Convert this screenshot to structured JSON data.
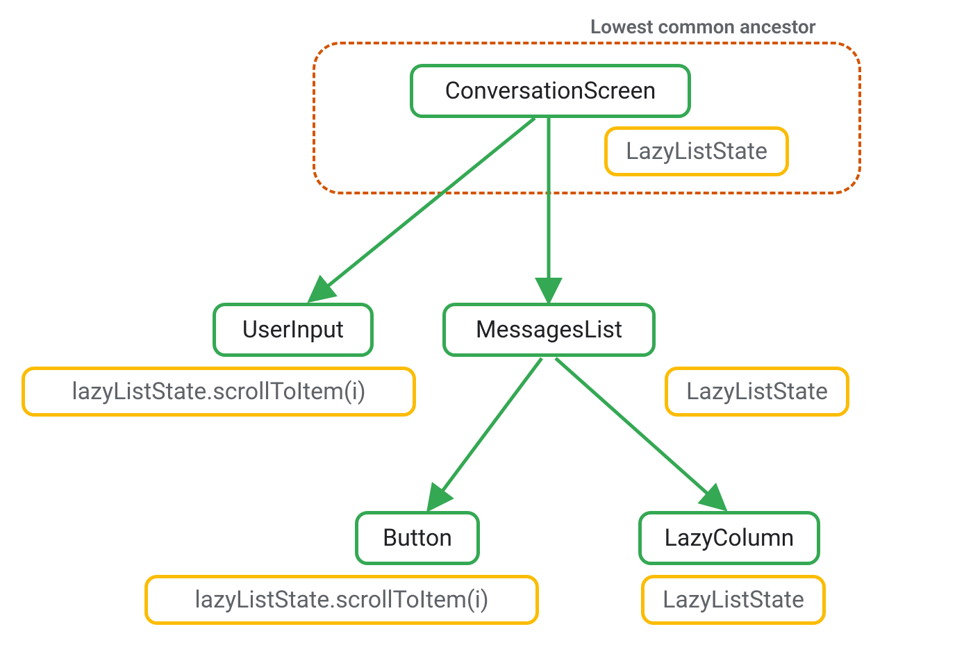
{
  "title_label": "Lowest common ancestor",
  "nodes": {
    "conversation_screen": "ConversationScreen",
    "conversation_screen_state": "LazyListState",
    "user_input": "UserInput",
    "user_input_state": "lazyListState.scrollToItem(i)",
    "messages_list": "MessagesList",
    "messages_list_state": "LazyListState",
    "button": "Button",
    "button_state": "lazyListState.scrollToItem(i)",
    "lazy_column": "LazyColumn",
    "lazy_column_state": "LazyListState"
  },
  "colors": {
    "green": "#34a853",
    "yellow": "#fbbc04",
    "dashed": "#d35400",
    "text_primary": "#202124",
    "text_secondary": "#5f6368"
  }
}
